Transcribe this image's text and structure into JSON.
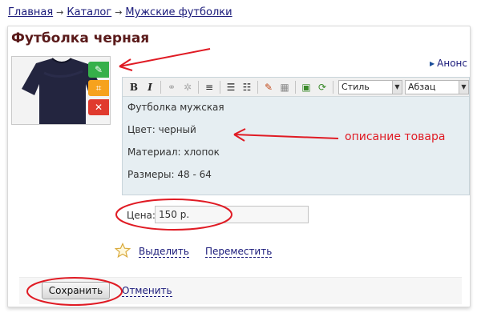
{
  "breadcrumb": {
    "items": [
      "Главная",
      "Каталог",
      "Мужские футболки"
    ],
    "separator": "→"
  },
  "product": {
    "title": "Футболка черная",
    "image_alt_icon": "tshirt-photo"
  },
  "image_tools": {
    "edit_icon": "pencil-icon",
    "crop_icon": "crop-icon",
    "delete_icon": "close-icon",
    "edit_color": "#36b04a",
    "crop_color": "#f6a21d",
    "delete_color": "#e03a2e"
  },
  "announce_label": "Анонс",
  "toolbar": {
    "bold": "B",
    "italic": "I",
    "style_select": "Стиль",
    "format_select": "Абзац"
  },
  "description": {
    "lines": [
      "Футболка мужская",
      "Цвет: черный",
      "Материал: хлопок",
      "Размеры: 48 - 64"
    ]
  },
  "annotation": {
    "text": "описание товара",
    "color": "#e01b24"
  },
  "price": {
    "label": "Цена:",
    "value": "150 р."
  },
  "actions": {
    "highlight": "Выделить",
    "move": "Переместить"
  },
  "footer": {
    "save": "Сохранить",
    "cancel": "Отменить"
  },
  "colors": {
    "link": "#1a1a7a",
    "title": "#5a1a1a",
    "accent_red": "#e01b24"
  }
}
